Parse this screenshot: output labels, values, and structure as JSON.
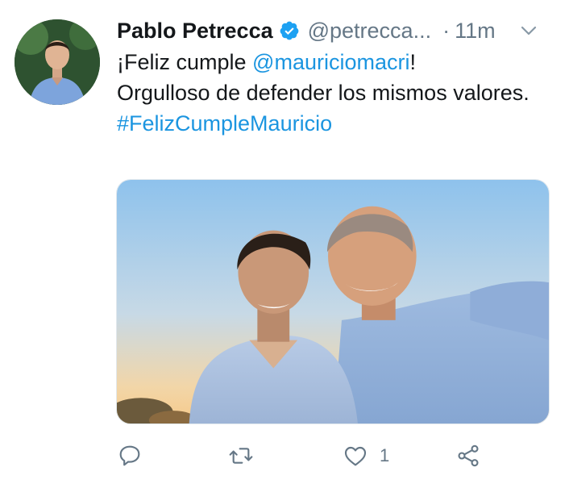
{
  "tweet": {
    "author": {
      "display_name": "Pablo Petrecca",
      "handle": "@petrecca...",
      "verified": true
    },
    "separator": "·",
    "time": "11m",
    "text": {
      "greeting": "¡Feliz cumple ",
      "mention": "@mauriciomacri",
      "exclaim": "!",
      "line2": "Orgulloso de defender los mismos valores.",
      "hashtag": "#FelizCumpleMauricio"
    },
    "actions": {
      "reply_icon": "reply-icon",
      "retweet_icon": "retweet-icon",
      "like_icon": "heart-icon",
      "like_count": "1",
      "share_icon": "share-icon"
    }
  },
  "colors": {
    "link": "#1b95e0",
    "secondary_text": "#657786",
    "verified_badge": "#1da1f2"
  }
}
